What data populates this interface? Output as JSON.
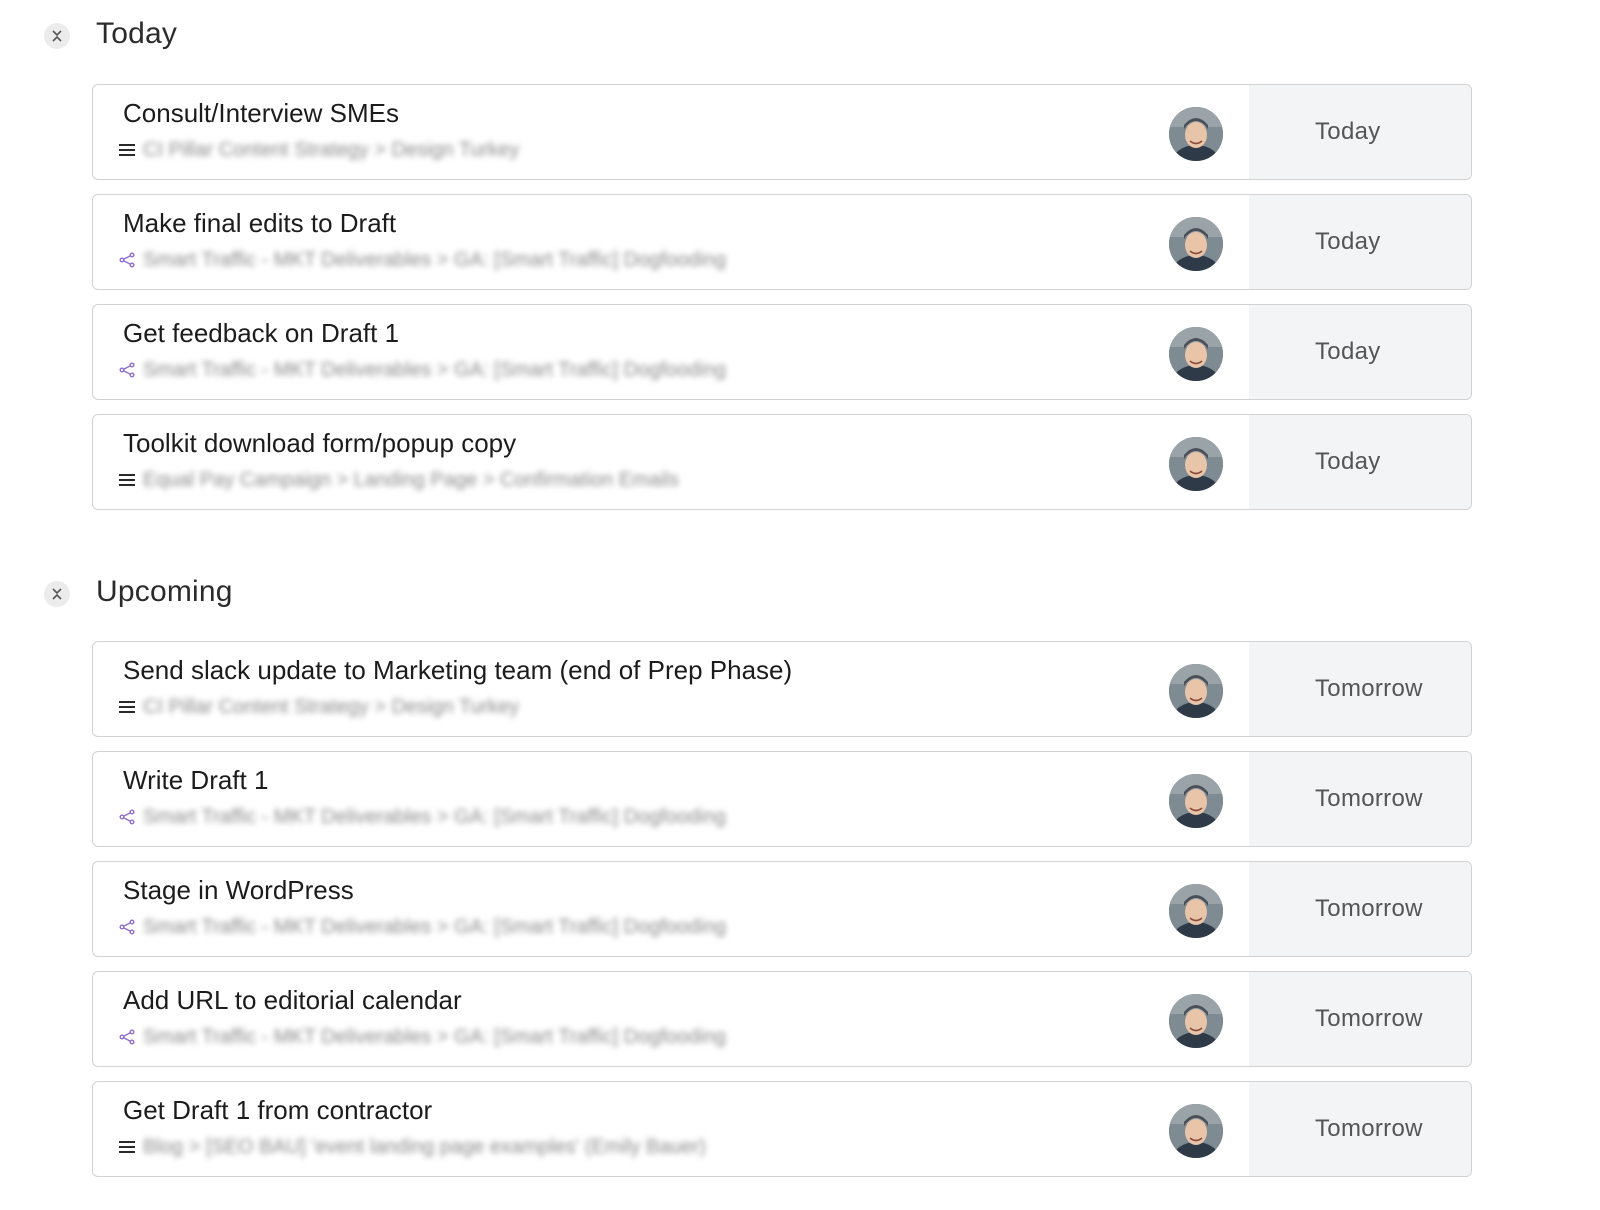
{
  "sections": [
    {
      "title": "Today",
      "tasks": [
        {
          "title": "Consult/Interview SMEs",
          "kind": "list",
          "path": "CI Pillar Content Strategy > Design Turkey",
          "due": "Today"
        },
        {
          "title": "Make final edits to Draft",
          "kind": "subtask",
          "path": "Smart Traffic - MKT Deliverables > GA: [Smart Traffic] Dogfooding",
          "due": "Today"
        },
        {
          "title": "Get feedback on Draft 1",
          "kind": "subtask",
          "path": "Smart Traffic - MKT Deliverables > GA: [Smart Traffic] Dogfooding",
          "due": "Today"
        },
        {
          "title": "Toolkit download form/popup copy",
          "kind": "list",
          "path": "Equal Pay Campaign > Landing Page > Confirmation Emails",
          "due": "Today"
        }
      ]
    },
    {
      "title": "Upcoming",
      "tasks": [
        {
          "title": "Send slack update to Marketing team (end of Prep Phase)",
          "kind": "list",
          "path": "CI Pillar Content Strategy > Design Turkey",
          "due": "Tomorrow"
        },
        {
          "title": "Write Draft 1",
          "kind": "subtask",
          "path": "Smart Traffic - MKT Deliverables > GA: [Smart Traffic] Dogfooding",
          "due": "Tomorrow"
        },
        {
          "title": "Stage in WordPress",
          "kind": "subtask",
          "path": "Smart Traffic - MKT Deliverables > GA: [Smart Traffic] Dogfooding",
          "due": "Tomorrow"
        },
        {
          "title": "Add URL to editorial calendar",
          "kind": "subtask",
          "path": "Smart Traffic - MKT Deliverables > GA: [Smart Traffic] Dogfooding",
          "due": "Tomorrow"
        },
        {
          "title": "Get Draft 1 from contractor",
          "kind": "list",
          "path": "Blog > [SEO BAU] 'event landing page examples' (Emily Bauer)",
          "due": "Tomorrow"
        }
      ]
    }
  ],
  "colors": {
    "subtask_icon": "#8e6bd8",
    "list_icon": "#2a2a2a",
    "due_bg": "#f3f4f6"
  },
  "icons": {
    "collapse": "collapse-chevrons-icon",
    "list": "list-lines-icon",
    "subtask": "subtask-branch-icon"
  }
}
